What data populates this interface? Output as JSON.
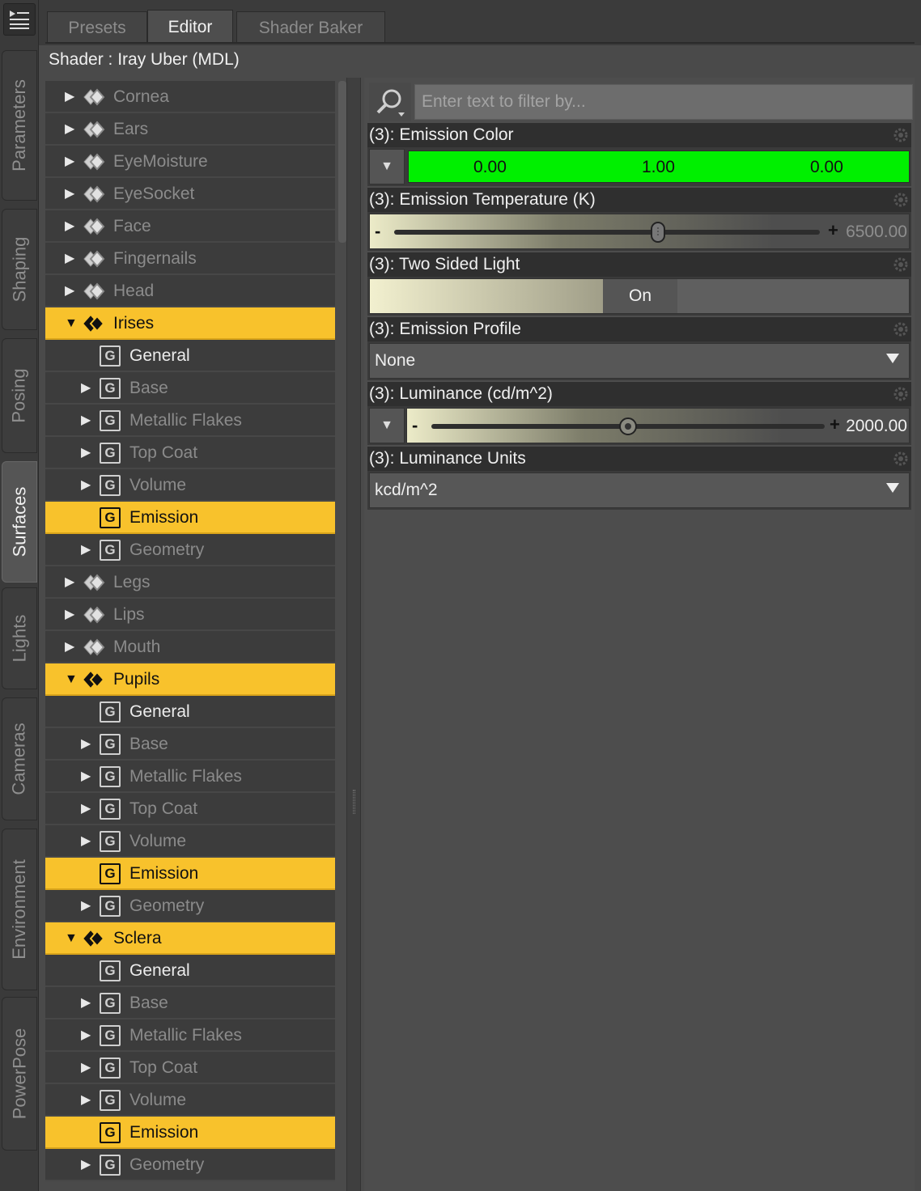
{
  "left_tabs": [
    "Parameters",
    "Shaping",
    "Posing",
    "Surfaces",
    "Lights",
    "Cameras",
    "Environment",
    "PowerPose"
  ],
  "active_left_tab": "Surfaces",
  "top_tabs": [
    "Presets",
    "Editor",
    "Shader Baker"
  ],
  "active_top_tab": "Editor",
  "shader_title": "Shader : Iray Uber (MDL)",
  "tree": [
    {
      "label": "Cornea",
      "kind": "material",
      "state": "collapsed"
    },
    {
      "label": "Ears",
      "kind": "material",
      "state": "collapsed"
    },
    {
      "label": "EyeMoisture",
      "kind": "material",
      "state": "collapsed"
    },
    {
      "label": "EyeSocket",
      "kind": "material",
      "state": "collapsed"
    },
    {
      "label": "Face",
      "kind": "material",
      "state": "collapsed"
    },
    {
      "label": "Fingernails",
      "kind": "material",
      "state": "collapsed"
    },
    {
      "label": "Head",
      "kind": "material",
      "state": "collapsed"
    },
    {
      "label": "Irises",
      "kind": "material",
      "state": "expanded"
    },
    {
      "label": "General",
      "kind": "group",
      "state": "leaf"
    },
    {
      "label": "Base",
      "kind": "group",
      "state": "collapsed"
    },
    {
      "label": "Metallic Flakes",
      "kind": "group",
      "state": "collapsed"
    },
    {
      "label": "Top Coat",
      "kind": "group",
      "state": "collapsed"
    },
    {
      "label": "Volume",
      "kind": "group",
      "state": "collapsed"
    },
    {
      "label": "Emission",
      "kind": "group",
      "state": "selected"
    },
    {
      "label": "Geometry",
      "kind": "group",
      "state": "collapsed"
    },
    {
      "label": "Legs",
      "kind": "material",
      "state": "collapsed"
    },
    {
      "label": "Lips",
      "kind": "material",
      "state": "collapsed"
    },
    {
      "label": "Mouth",
      "kind": "material",
      "state": "collapsed"
    },
    {
      "label": "Pupils",
      "kind": "material",
      "state": "expanded"
    },
    {
      "label": "General",
      "kind": "group",
      "state": "leaf"
    },
    {
      "label": "Base",
      "kind": "group",
      "state": "collapsed"
    },
    {
      "label": "Metallic Flakes",
      "kind": "group",
      "state": "collapsed"
    },
    {
      "label": "Top Coat",
      "kind": "group",
      "state": "collapsed"
    },
    {
      "label": "Volume",
      "kind": "group",
      "state": "collapsed"
    },
    {
      "label": "Emission",
      "kind": "group",
      "state": "selected"
    },
    {
      "label": "Geometry",
      "kind": "group",
      "state": "collapsed"
    },
    {
      "label": "Sclera",
      "kind": "material",
      "state": "expanded"
    },
    {
      "label": "General",
      "kind": "group",
      "state": "leaf"
    },
    {
      "label": "Base",
      "kind": "group",
      "state": "collapsed"
    },
    {
      "label": "Metallic Flakes",
      "kind": "group",
      "state": "collapsed"
    },
    {
      "label": "Top Coat",
      "kind": "group",
      "state": "collapsed"
    },
    {
      "label": "Volume",
      "kind": "group",
      "state": "collapsed"
    },
    {
      "label": "Emission",
      "kind": "group",
      "state": "selected"
    },
    {
      "label": "Geometry",
      "kind": "group",
      "state": "collapsed"
    }
  ],
  "filter": {
    "placeholder": "Enter text to filter by..."
  },
  "props": {
    "emission_color": {
      "label": "(3): Emission Color",
      "r": "0.00",
      "g": "1.00",
      "b": "0.00",
      "color": "#00f000"
    },
    "emission_temp": {
      "label": "(3): Emission Temperature (K)",
      "minus": "-",
      "plus": "+",
      "value": "6500.00",
      "level": 0.62
    },
    "two_sided": {
      "label": "(3): Two Sided Light",
      "value": "On"
    },
    "emission_profile": {
      "label": "(3): Emission Profile",
      "value": "None"
    },
    "luminance": {
      "label": "(3): Luminance (cd/m^2)",
      "minus": "-",
      "plus": "+",
      "value": "2000.00",
      "level": 0.5
    },
    "luminance_units": {
      "label": "(3): Luminance Units",
      "value": "kcd/m^2"
    }
  },
  "colors": {
    "selection": "#f8c22c",
    "emission": "#00f000"
  }
}
